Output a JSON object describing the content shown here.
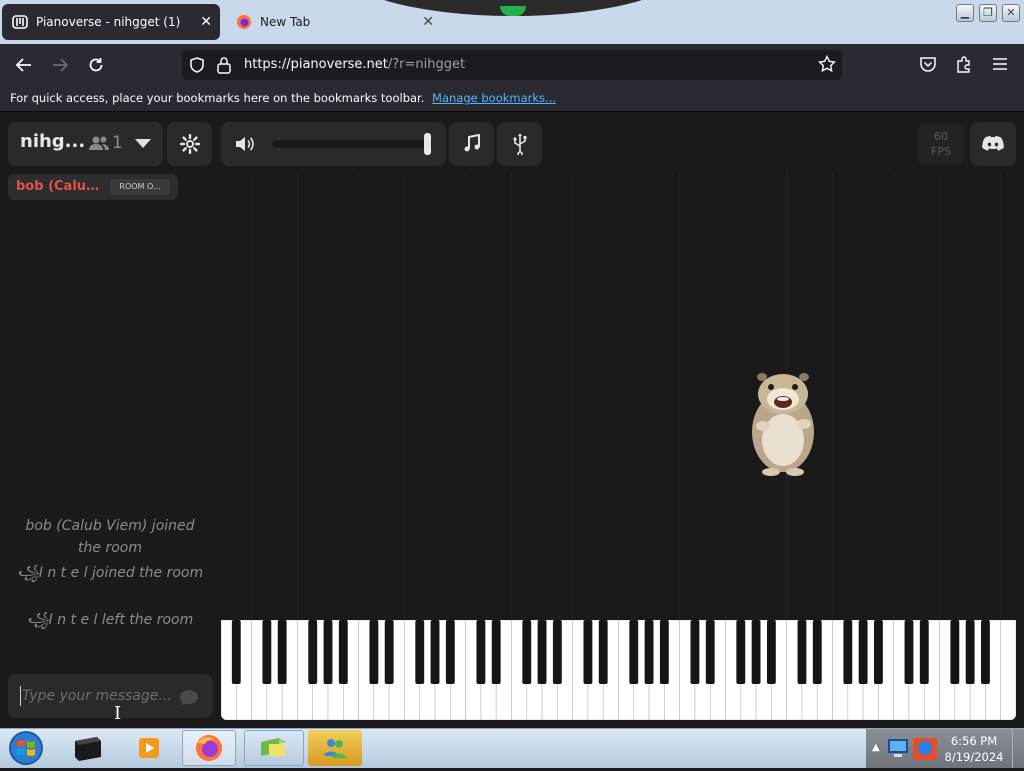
{
  "browser": {
    "tabs": [
      {
        "title": "Pianoverse - nihgget (1)",
        "active": true,
        "icon": "pianoverse-logo-icon"
      },
      {
        "title": "New Tab",
        "active": false,
        "icon": "firefox-icon"
      }
    ],
    "url_host": "https://pianoverse.net",
    "url_path": "/?r=nihgget",
    "bookmarks_message": "For quick access, place your bookmarks here on the bookmarks toolbar.",
    "bookmarks_link": "Manage bookmarks..."
  },
  "room": {
    "name": "nihg...",
    "user_count": "1"
  },
  "audio": {
    "volume_fraction": 1.0
  },
  "fps": {
    "value": "60",
    "label": "FPS"
  },
  "users": [
    {
      "name": "bob (Calub ...",
      "badge": "ROOM O..."
    }
  ],
  "chat": {
    "messages": [
      "bob (Calub Viem) joined the room",
      "꧁I n t e l joined the room",
      "꧁I n t e l left the room"
    ],
    "placeholder": "Type your message..."
  },
  "taskbar": {
    "time": "6:56 PM",
    "date": "8/19/2024"
  },
  "colors": {
    "accent_user": "#e0524a",
    "link": "#52b8f2",
    "panel": "#2a2a2c",
    "background": "#1b1b1d"
  }
}
